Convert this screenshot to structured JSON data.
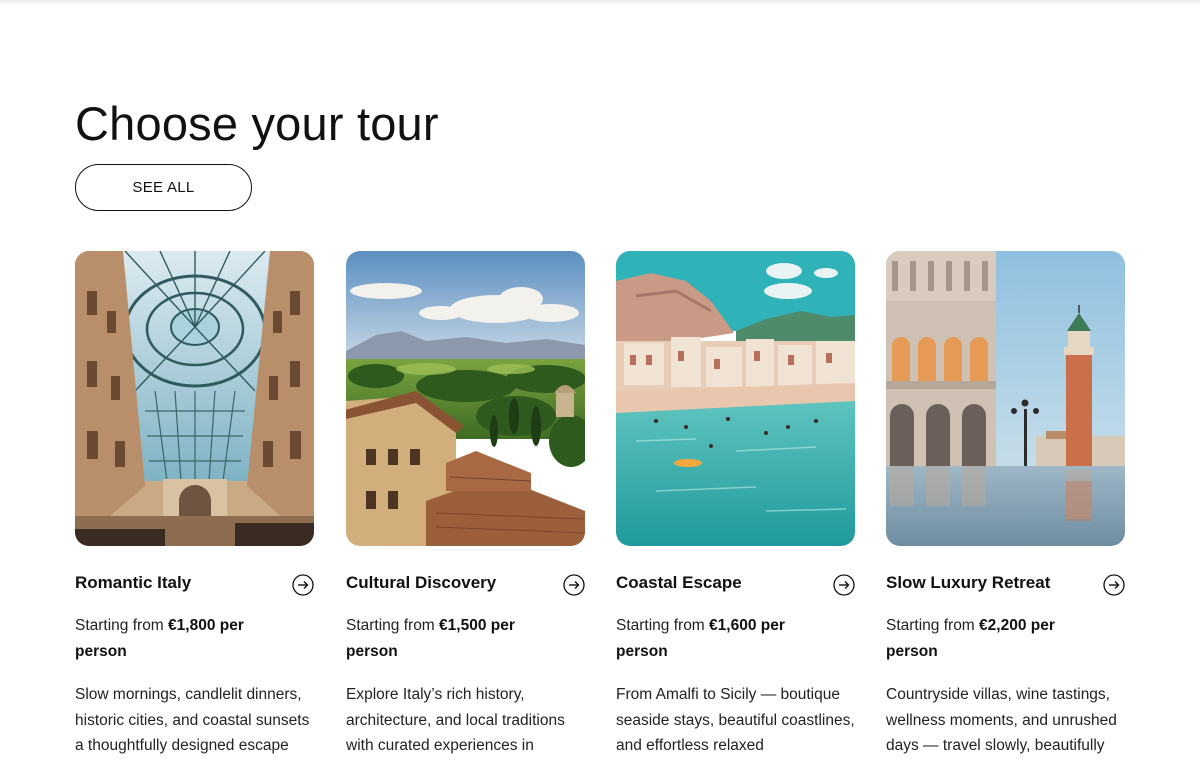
{
  "section": {
    "title": "Choose your tour",
    "see_all_label": "SEE ALL"
  },
  "tours": [
    {
      "title": "Romantic Italy",
      "price_prefix": "Starting from",
      "price_amount": "€1,800 per person",
      "description": "Slow mornings, candlelit dinners, historic cities, and coastal sunsets a thoughtfully designed escape",
      "image_icon": "galleria-arcade-dome-photo",
      "arrow_icon": "arrow-right-circle-icon"
    },
    {
      "title": "Cultural Discovery",
      "price_prefix": "Starting from",
      "price_amount": "€1,500 per person",
      "description": "Explore Italy’s rich history, architecture, and local traditions with curated experiences in",
      "image_icon": "tuscan-village-landscape-photo",
      "arrow_icon": "arrow-right-circle-icon"
    },
    {
      "title": "Coastal Escape",
      "price_prefix": "Starting from",
      "price_amount": "€1,600 per person",
      "description": "From Amalfi to Sicily — boutique seaside stays, beautiful coastlines, and effortless relaxed",
      "image_icon": "seaside-town-beach-photo",
      "arrow_icon": "arrow-right-circle-icon"
    },
    {
      "title": "Slow Luxury Retreat",
      "price_prefix": "Starting from",
      "price_amount": "€2,200 per person",
      "description": "Countryside villas, wine tastings, wellness moments, and unrushed days — travel slowly, beautifully",
      "image_icon": "venice-palace-campanile-photo",
      "arrow_icon": "arrow-right-circle-icon"
    }
  ]
}
